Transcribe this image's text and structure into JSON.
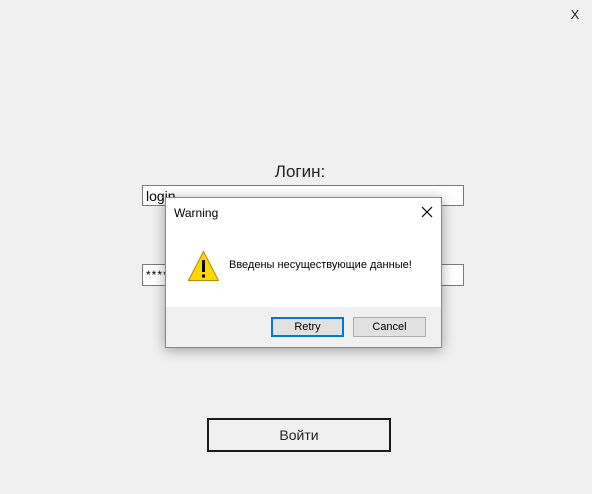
{
  "window": {
    "close_label": "X"
  },
  "form": {
    "login_label": "Логин:",
    "login_value": "login",
    "password_value": "*****",
    "enter_button": "Войти"
  },
  "dialog": {
    "title": "Warning",
    "message": "Введены несуществующие данные!",
    "icon": "warning-icon",
    "retry_label": "Retry",
    "cancel_label": "Cancel",
    "accent_color": "#0078d7",
    "icon_color": "#ffd600"
  }
}
